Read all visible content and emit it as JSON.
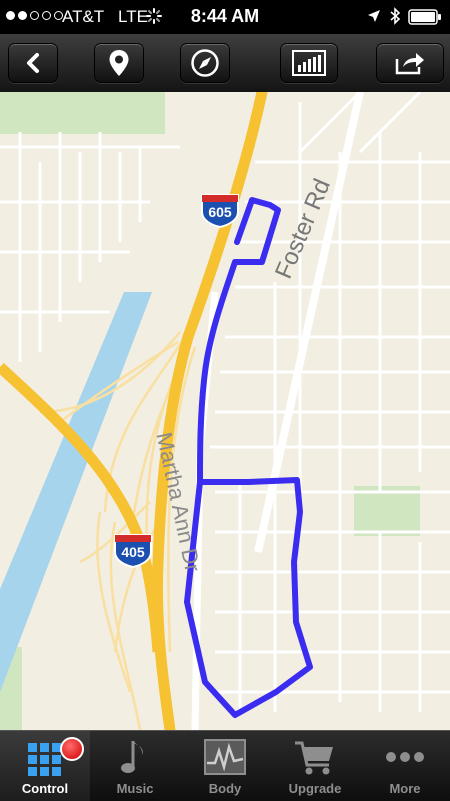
{
  "status_bar": {
    "carrier": "AT&T",
    "network": "LTE",
    "time": "8:44 AM",
    "signal_bars": 2,
    "signal_total": 5
  },
  "toolbar": {
    "buttons": [
      "back",
      "location-pin",
      "compass",
      "bar-chart",
      "share"
    ]
  },
  "map": {
    "streets": [
      "Foster Rd",
      "Martha Ann Dr"
    ],
    "shields": [
      "605",
      "405"
    ],
    "shield_header": "INTERSTATE",
    "route_color": "#3b2df0",
    "freeway_color": "#f6c232"
  },
  "tabs": [
    {
      "label": "Control",
      "icon": "grid-icon",
      "active": true
    },
    {
      "label": "Music",
      "icon": "music-note-icon",
      "active": false
    },
    {
      "label": "Body",
      "icon": "heart-rate-icon",
      "active": false
    },
    {
      "label": "Upgrade",
      "icon": "cart-icon",
      "active": false
    },
    {
      "label": "More",
      "icon": "more-dots-icon",
      "active": false
    }
  ]
}
